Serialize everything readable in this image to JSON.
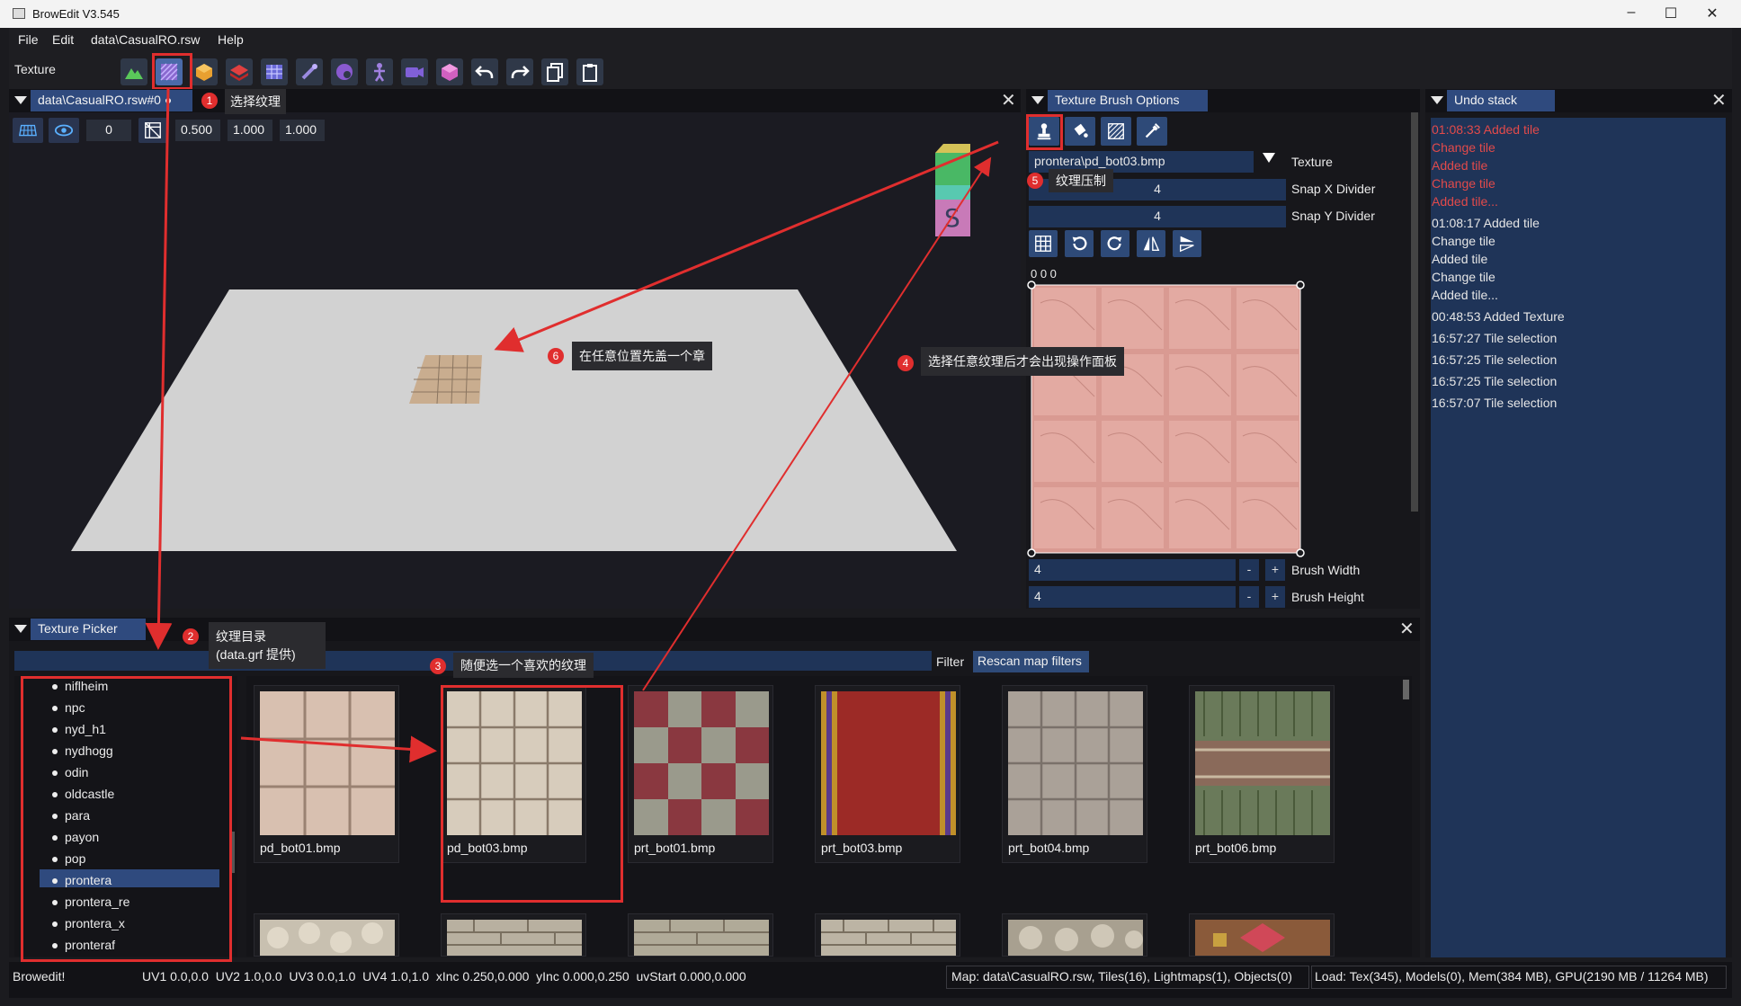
{
  "window": {
    "title": "BrowEdit V3.545",
    "minimize": "–",
    "maximize": "☐",
    "close": "✕"
  },
  "menu": [
    "File",
    "Edit",
    "data\\CasualRO.rsw",
    "Help"
  ],
  "toolbar": {
    "mode_label": "Texture",
    "buttons": [
      "height-edit-icon",
      "texture-edit-icon",
      "object-edit-icon",
      "wall-edit-icon",
      "gat-edit-icon",
      "sprite-edit-icon",
      "color-edit-icon",
      "shadow-edit-icon",
      "cinematic-edit-icon",
      "cube-icon",
      "undo-icon",
      "redo-icon",
      "copy-icon",
      "paste-icon"
    ]
  },
  "viewport": {
    "tab": "data\\CasualRO.rsw#0",
    "modified_dot": "●",
    "controls": {
      "value0": "0",
      "v1": "0.500",
      "v2": "1.000",
      "v3": "1.000"
    }
  },
  "brush_options": {
    "tab": "Texture Brush Options",
    "texture_value": "prontera\\pd_bot03.bmp",
    "texture_label": "Texture",
    "snap_x_value": "4",
    "snap_x_label": "Snap X Divider",
    "snap_y_value": "4",
    "snap_y_label": "Snap Y Divider",
    "coords": "0 0 0",
    "brush_width_value": "4",
    "brush_width_label": "Brush Width",
    "brush_height_value": "4",
    "brush_height_label": "Brush Height",
    "minus": "-",
    "plus": "+"
  },
  "undo": {
    "tab": "Undo stack",
    "red_items": [
      "01:08:33 Added tile",
      "Change tile",
      "Added tile",
      "Change tile",
      "Added tile..."
    ],
    "items": [
      "01:08:17 Added tile",
      "Change tile",
      "Added tile",
      "Change tile",
      "Added tile...",
      "00:48:53 Added Texture",
      "16:57:27 Tile selection",
      "16:57:25 Tile selection",
      "16:57:25 Tile selection",
      "16:57:07 Tile selection"
    ]
  },
  "picker": {
    "tab": "Texture Picker",
    "filter_label": "Filter",
    "rescan": "Rescan map filters",
    "tree": [
      "niflheim",
      "npc",
      "nyd_h1",
      "nydhogg",
      "odin",
      "oldcastle",
      "para",
      "payon",
      "pop",
      "prontera",
      "prontera_re",
      "prontera_x",
      "pronteraf"
    ],
    "selected": "prontera",
    "textures": [
      "pd_bot01.bmp",
      "pd_bot03.bmp",
      "prt_bot01.bmp",
      "prt_bot03.bmp",
      "prt_bot04.bmp",
      "prt_bot06.bmp"
    ]
  },
  "annotations": [
    {
      "n": "1",
      "text": "选择纹理"
    },
    {
      "n": "2",
      "text": "纹理目录",
      "text2": "(data.grf 提供)"
    },
    {
      "n": "3",
      "text": "随便选一个喜欢的纹理"
    },
    {
      "n": "4",
      "text": "选择任意纹理后才会出现操作面板"
    },
    {
      "n": "5",
      "text": "纹理压制"
    },
    {
      "n": "6",
      "text": "在任意位置先盖一个章"
    }
  ],
  "statusbar": {
    "app": "Browedit!",
    "uv": "UV1 0.0,0.0  UV2 1.0,0.0  UV3 0.0,1.0  UV4 1.0,1.0  xInc 0.250,0.000  yInc 0.000,0.250  uvStart 0.000,0.000",
    "map": "Map: data\\CasualRO.rsw, Tiles(16), Lightmaps(1), Objects(0)",
    "load": "Load: Tex(345), Models(0), Mem(384 MB), GPU(2190 MB / 11264 MB)"
  },
  "colors": {
    "accent": "#2f4a7e",
    "annotation_red": "#e02e2e",
    "undo_red": "#e24a4a"
  }
}
